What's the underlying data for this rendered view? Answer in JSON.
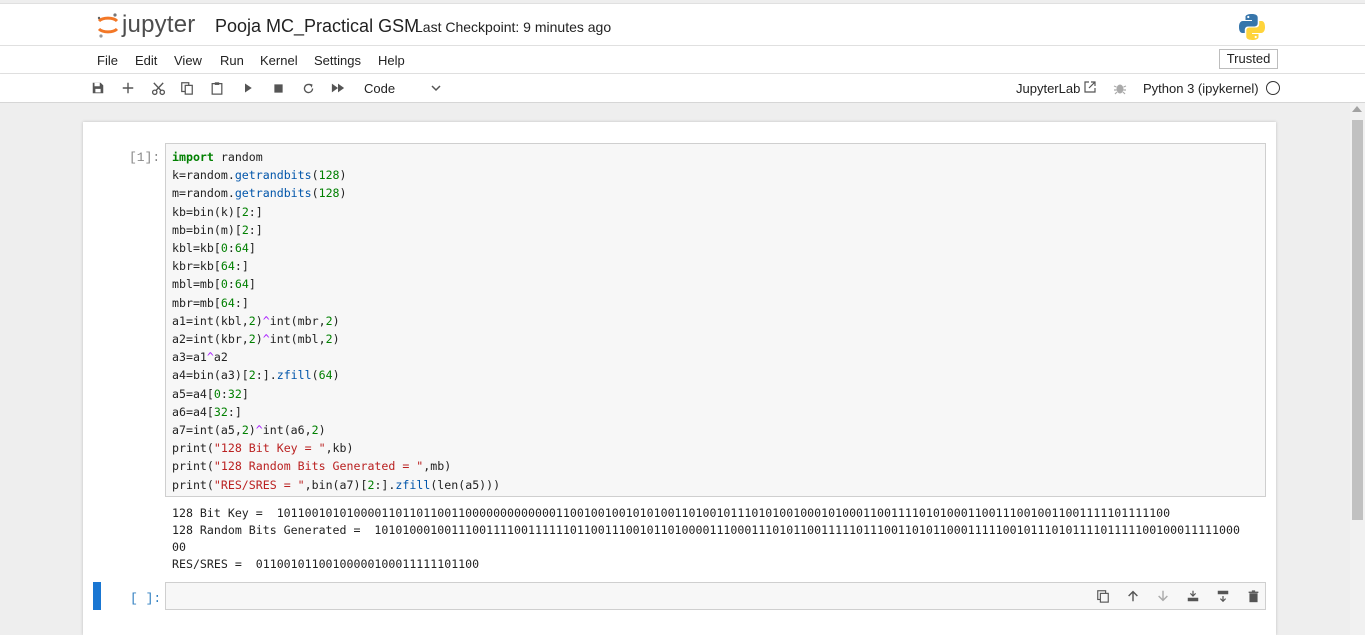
{
  "header": {
    "logo_text": "jupyter",
    "notebook_title": "Pooja MC_Practical GSM",
    "checkpoint": "Last Checkpoint: 9 minutes ago",
    "trusted": "Trusted"
  },
  "menu": [
    "File",
    "Edit",
    "View",
    "Run",
    "Kernel",
    "Settings",
    "Help"
  ],
  "toolbar": {
    "cell_type": "Code",
    "jupyterlab_link": "JupyterLab",
    "kernel_name": "Python 3 (ipykernel)"
  },
  "cells": [
    {
      "prompt": "[1]:",
      "output_lines": [
        "128 Bit Key =  10110010101000011011011001100000000000001100100100101010011010010111010100100010100011001111010100011001110010011001111101111100",
        "128 Random Bits Generated =  1010100010011100111100111111011001110010110100001110001110101100111110111001101011000111110010111010111101111100100011111000",
        "00",
        "RES/SRES =  01100101100100000100011111101100"
      ]
    },
    {
      "prompt": "[ ]:"
    }
  ],
  "colors": {
    "active_cell_bar": "#1976d2",
    "background": "#eeeeee",
    "keyword": "#008000",
    "string": "#ba2121"
  }
}
